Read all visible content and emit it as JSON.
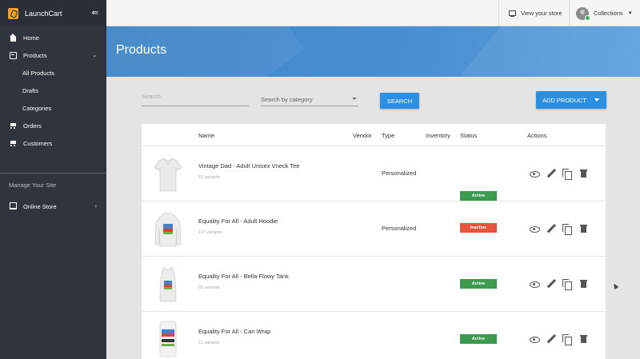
{
  "brand": {
    "name": "LaunchCart"
  },
  "sidebar": {
    "items": [
      {
        "label": "Home"
      },
      {
        "label": "Products"
      },
      {
        "label": "All Products"
      },
      {
        "label": "Drafts"
      },
      {
        "label": "Categories"
      },
      {
        "label": "Orders"
      },
      {
        "label": "Customers"
      }
    ],
    "section_label": "Manage Your Site",
    "online_store": "Online Store"
  },
  "topbar": {
    "view_store": "View your store",
    "collections": "Collections"
  },
  "hero": {
    "title": "Products"
  },
  "filters": {
    "search_placeholder": "Search",
    "category_placeholder": "Search by category",
    "search_button": "SEARCH",
    "add_button": "ADD PRODUCT"
  },
  "table": {
    "headers": [
      "Name",
      "Vendor",
      "Type",
      "Inventory",
      "Status",
      "Actions"
    ],
    "rows": [
      {
        "name": "Vintage Dad - Adult Unisex Vneck Tee",
        "variants": "15 variants",
        "type": "Personalized",
        "status": "Active"
      },
      {
        "name": "Equality For All - Adult Hoodie",
        "variants": "117 variants",
        "type": "Personalized",
        "status": "Inactive"
      },
      {
        "name": "Equality For All - Bella Flowy Tank",
        "variants": "55 variants",
        "type": "",
        "status": "Active"
      },
      {
        "name": "Equality For All - Can Wrap",
        "variants": "11 variants",
        "type": "",
        "status": "Active"
      }
    ]
  },
  "colors": {
    "accent": "#2d8fe0",
    "active": "#3c9a4e",
    "inactive": "#e5553c",
    "sidebar": "#2f343d"
  }
}
